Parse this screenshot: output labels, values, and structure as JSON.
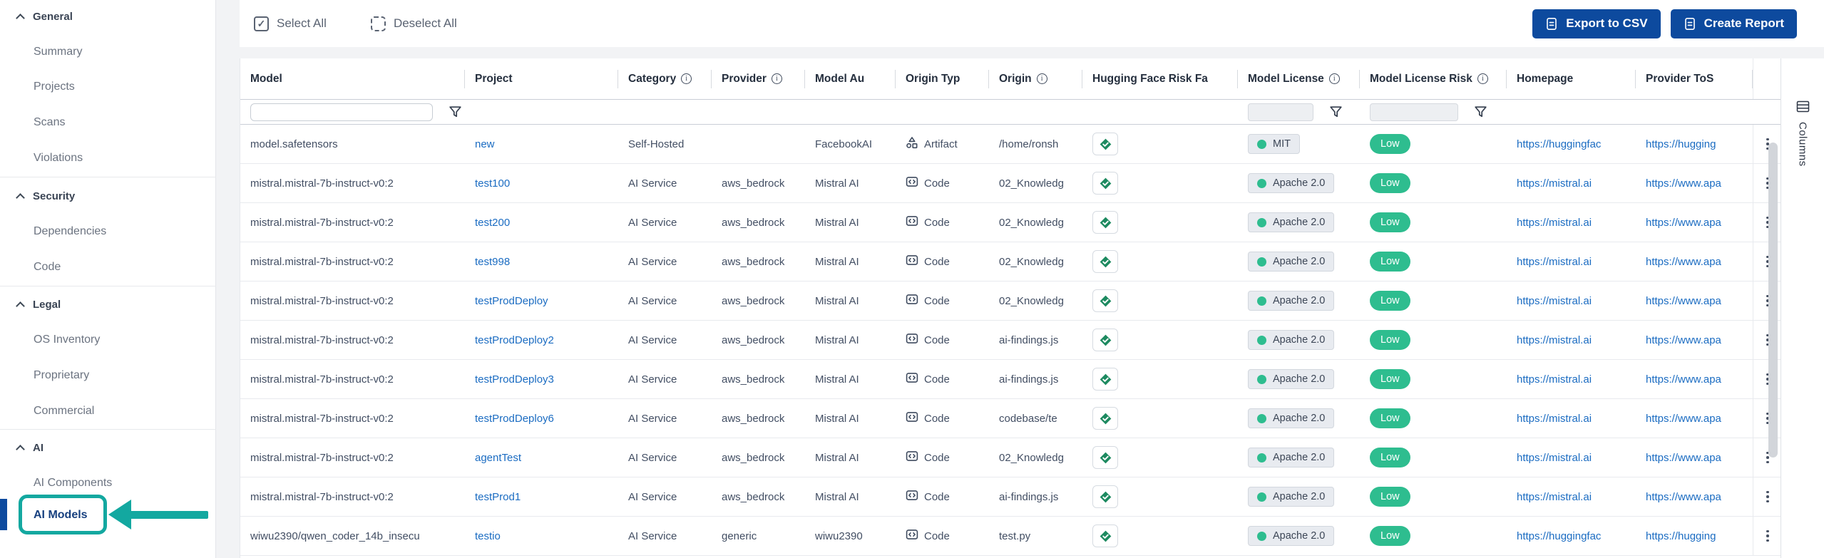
{
  "sidebar": {
    "groups": [
      {
        "label": "General",
        "items": [
          "Summary",
          "Projects",
          "Scans",
          "Violations"
        ]
      },
      {
        "label": "Security",
        "items": [
          "Dependencies",
          "Code"
        ]
      },
      {
        "label": "Legal",
        "items": [
          "OS Inventory",
          "Proprietary",
          "Commercial"
        ]
      },
      {
        "label": "AI",
        "items": [
          "AI Components",
          "AI Models"
        ]
      }
    ],
    "active_item": "AI Models"
  },
  "toolbar": {
    "select_all_label": "Select All",
    "deselect_all_label": "Deselect All",
    "export_csv_label": "Export to CSV",
    "create_report_label": "Create Report"
  },
  "columns_panel": {
    "label": "Columns"
  },
  "colors": {
    "accent_teal": "#13a8a0",
    "navy": "#0d4a9e",
    "green": "#2ebd8f",
    "link_blue": "#1b6cc2"
  },
  "table": {
    "columns": [
      {
        "label": "Model",
        "info": false
      },
      {
        "label": "Project",
        "info": false
      },
      {
        "label": "Category",
        "info": true
      },
      {
        "label": "Provider",
        "info": true
      },
      {
        "label": "Model Au",
        "info": false
      },
      {
        "label": "Origin Typ",
        "info": false
      },
      {
        "label": "Origin",
        "info": true
      },
      {
        "label": "Hugging Face Risk Fa",
        "info": false
      },
      {
        "label": "Model License",
        "info": true
      },
      {
        "label": "Model License Risk",
        "info": true
      },
      {
        "label": "Homepage",
        "info": false
      },
      {
        "label": "Provider ToS",
        "info": false
      },
      {
        "label": "",
        "info": false
      }
    ],
    "rows": [
      {
        "model": "model.safetensors",
        "project": "new",
        "category": "Self-Hosted",
        "provider": "",
        "author": "FacebookAI",
        "origin_type": "Artifact",
        "origin_icon": "artifact",
        "origin": "/home/ronsh",
        "license": "MIT",
        "risk": "Low",
        "homepage": "https://huggingfac",
        "tos": "https://hugging"
      },
      {
        "model": "mistral.mistral-7b-instruct-v0:2",
        "project": "test100",
        "category": "AI Service",
        "provider": "aws_bedrock",
        "author": "Mistral AI",
        "origin_type": "Code",
        "origin_icon": "code",
        "origin": "02_Knowledg",
        "license": "Apache 2.0",
        "risk": "Low",
        "homepage": "https://mistral.ai",
        "tos": "https://www.apa"
      },
      {
        "model": "mistral.mistral-7b-instruct-v0:2",
        "project": "test200",
        "category": "AI Service",
        "provider": "aws_bedrock",
        "author": "Mistral AI",
        "origin_type": "Code",
        "origin_icon": "code",
        "origin": "02_Knowledg",
        "license": "Apache 2.0",
        "risk": "Low",
        "homepage": "https://mistral.ai",
        "tos": "https://www.apa"
      },
      {
        "model": "mistral.mistral-7b-instruct-v0:2",
        "project": "test998",
        "category": "AI Service",
        "provider": "aws_bedrock",
        "author": "Mistral AI",
        "origin_type": "Code",
        "origin_icon": "code",
        "origin": "02_Knowledg",
        "license": "Apache 2.0",
        "risk": "Low",
        "homepage": "https://mistral.ai",
        "tos": "https://www.apa"
      },
      {
        "model": "mistral.mistral-7b-instruct-v0:2",
        "project": "testProdDeploy",
        "category": "AI Service",
        "provider": "aws_bedrock",
        "author": "Mistral AI",
        "origin_type": "Code",
        "origin_icon": "code",
        "origin": "02_Knowledg",
        "license": "Apache 2.0",
        "risk": "Low",
        "homepage": "https://mistral.ai",
        "tos": "https://www.apa"
      },
      {
        "model": "mistral.mistral-7b-instruct-v0:2",
        "project": "testProdDeploy2",
        "category": "AI Service",
        "provider": "aws_bedrock",
        "author": "Mistral AI",
        "origin_type": "Code",
        "origin_icon": "code",
        "origin": "ai-findings.js",
        "license": "Apache 2.0",
        "risk": "Low",
        "homepage": "https://mistral.ai",
        "tos": "https://www.apa"
      },
      {
        "model": "mistral.mistral-7b-instruct-v0:2",
        "project": "testProdDeploy3",
        "category": "AI Service",
        "provider": "aws_bedrock",
        "author": "Mistral AI",
        "origin_type": "Code",
        "origin_icon": "code",
        "origin": "ai-findings.js",
        "license": "Apache 2.0",
        "risk": "Low",
        "homepage": "https://mistral.ai",
        "tos": "https://www.apa"
      },
      {
        "model": "mistral.mistral-7b-instruct-v0:2",
        "project": "testProdDeploy6",
        "category": "AI Service",
        "provider": "aws_bedrock",
        "author": "Mistral AI",
        "origin_type": "Code",
        "origin_icon": "code",
        "origin": "codebase/te",
        "license": "Apache 2.0",
        "risk": "Low",
        "homepage": "https://mistral.ai",
        "tos": "https://www.apa"
      },
      {
        "model": "mistral.mistral-7b-instruct-v0:2",
        "project": "agentTest",
        "category": "AI Service",
        "provider": "aws_bedrock",
        "author": "Mistral AI",
        "origin_type": "Code",
        "origin_icon": "code",
        "origin": "02_Knowledg",
        "license": "Apache 2.0",
        "risk": "Low",
        "homepage": "https://mistral.ai",
        "tos": "https://www.apa"
      },
      {
        "model": "mistral.mistral-7b-instruct-v0:2",
        "project": "testProd1",
        "category": "AI Service",
        "provider": "aws_bedrock",
        "author": "Mistral AI",
        "origin_type": "Code",
        "origin_icon": "code",
        "origin": "ai-findings.js",
        "license": "Apache 2.0",
        "risk": "Low",
        "homepage": "https://mistral.ai",
        "tos": "https://www.apa"
      },
      {
        "model": "wiwu2390/qwen_coder_14b_insecu",
        "project": "testio",
        "category": "AI Service",
        "provider": "generic",
        "author": "wiwu2390",
        "origin_type": "Code",
        "origin_icon": "code",
        "origin": "test.py",
        "license": "Apache 2.0",
        "risk": "Low",
        "homepage": "https://huggingfac",
        "tos": "https://hugging"
      }
    ]
  }
}
